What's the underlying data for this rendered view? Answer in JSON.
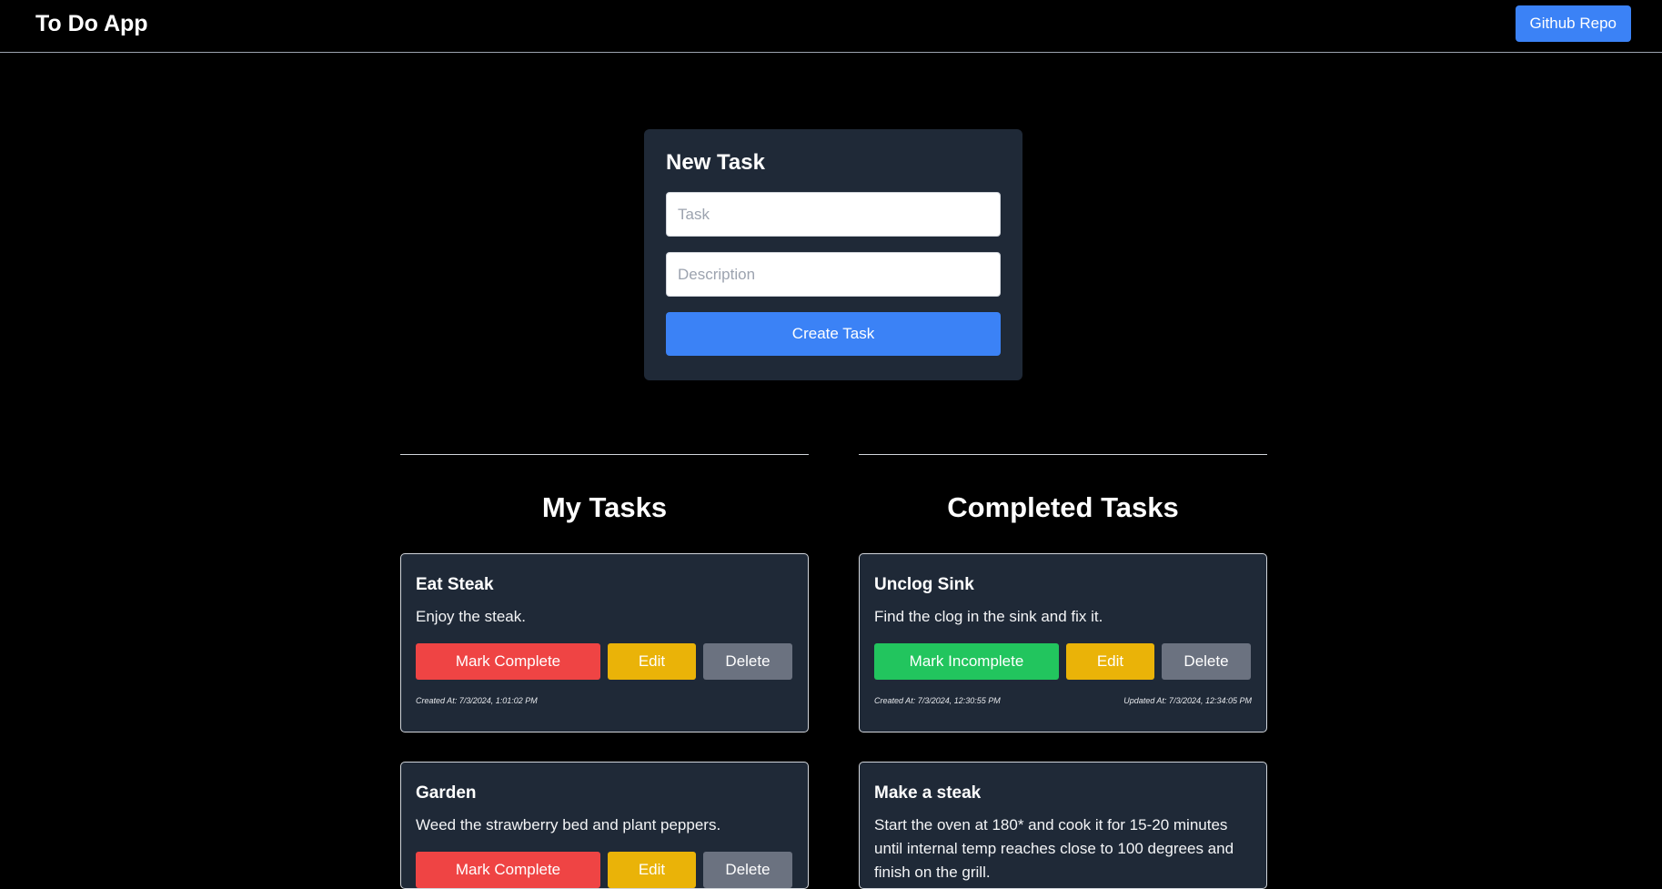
{
  "header": {
    "title": "To Do App",
    "github_label": "Github Repo"
  },
  "new_task": {
    "title": "New Task",
    "task_placeholder": "Task",
    "description_placeholder": "Description",
    "create_label": "Create Task"
  },
  "my_tasks": {
    "heading": "My Tasks",
    "items": [
      {
        "title": "Eat Steak",
        "description": "Enjoy the steak.",
        "primary_label": "Mark Complete",
        "edit_label": "Edit",
        "delete_label": "Delete",
        "created": "Created At: 7/3/2024, 1:01:02 PM",
        "updated": ""
      },
      {
        "title": "Garden",
        "description": "Weed the strawberry bed and plant peppers.",
        "primary_label": "Mark Complete",
        "edit_label": "Edit",
        "delete_label": "Delete"
      }
    ]
  },
  "completed_tasks": {
    "heading": "Completed Tasks",
    "items": [
      {
        "title": "Unclog Sink",
        "description": "Find the clog in the sink and fix it.",
        "primary_label": "Mark Incomplete",
        "edit_label": "Edit",
        "delete_label": "Delete",
        "created": "Created At: 7/3/2024, 12:30:55 PM",
        "updated": "Updated At: 7/3/2024, 12:34:05 PM"
      },
      {
        "title": "Make a steak",
        "description": "Start the oven at 180* and cook it for 15-20 minutes until internal temp reaches close to 100 degrees and finish on the grill."
      }
    ]
  },
  "colors": {
    "background": "#000000",
    "card": "#1f2937",
    "accent_blue": "#3b82f6",
    "complete_red": "#ef4444",
    "incomplete_green": "#22c55e",
    "edit_yellow": "#eab308",
    "delete_gray": "#6b7280"
  }
}
